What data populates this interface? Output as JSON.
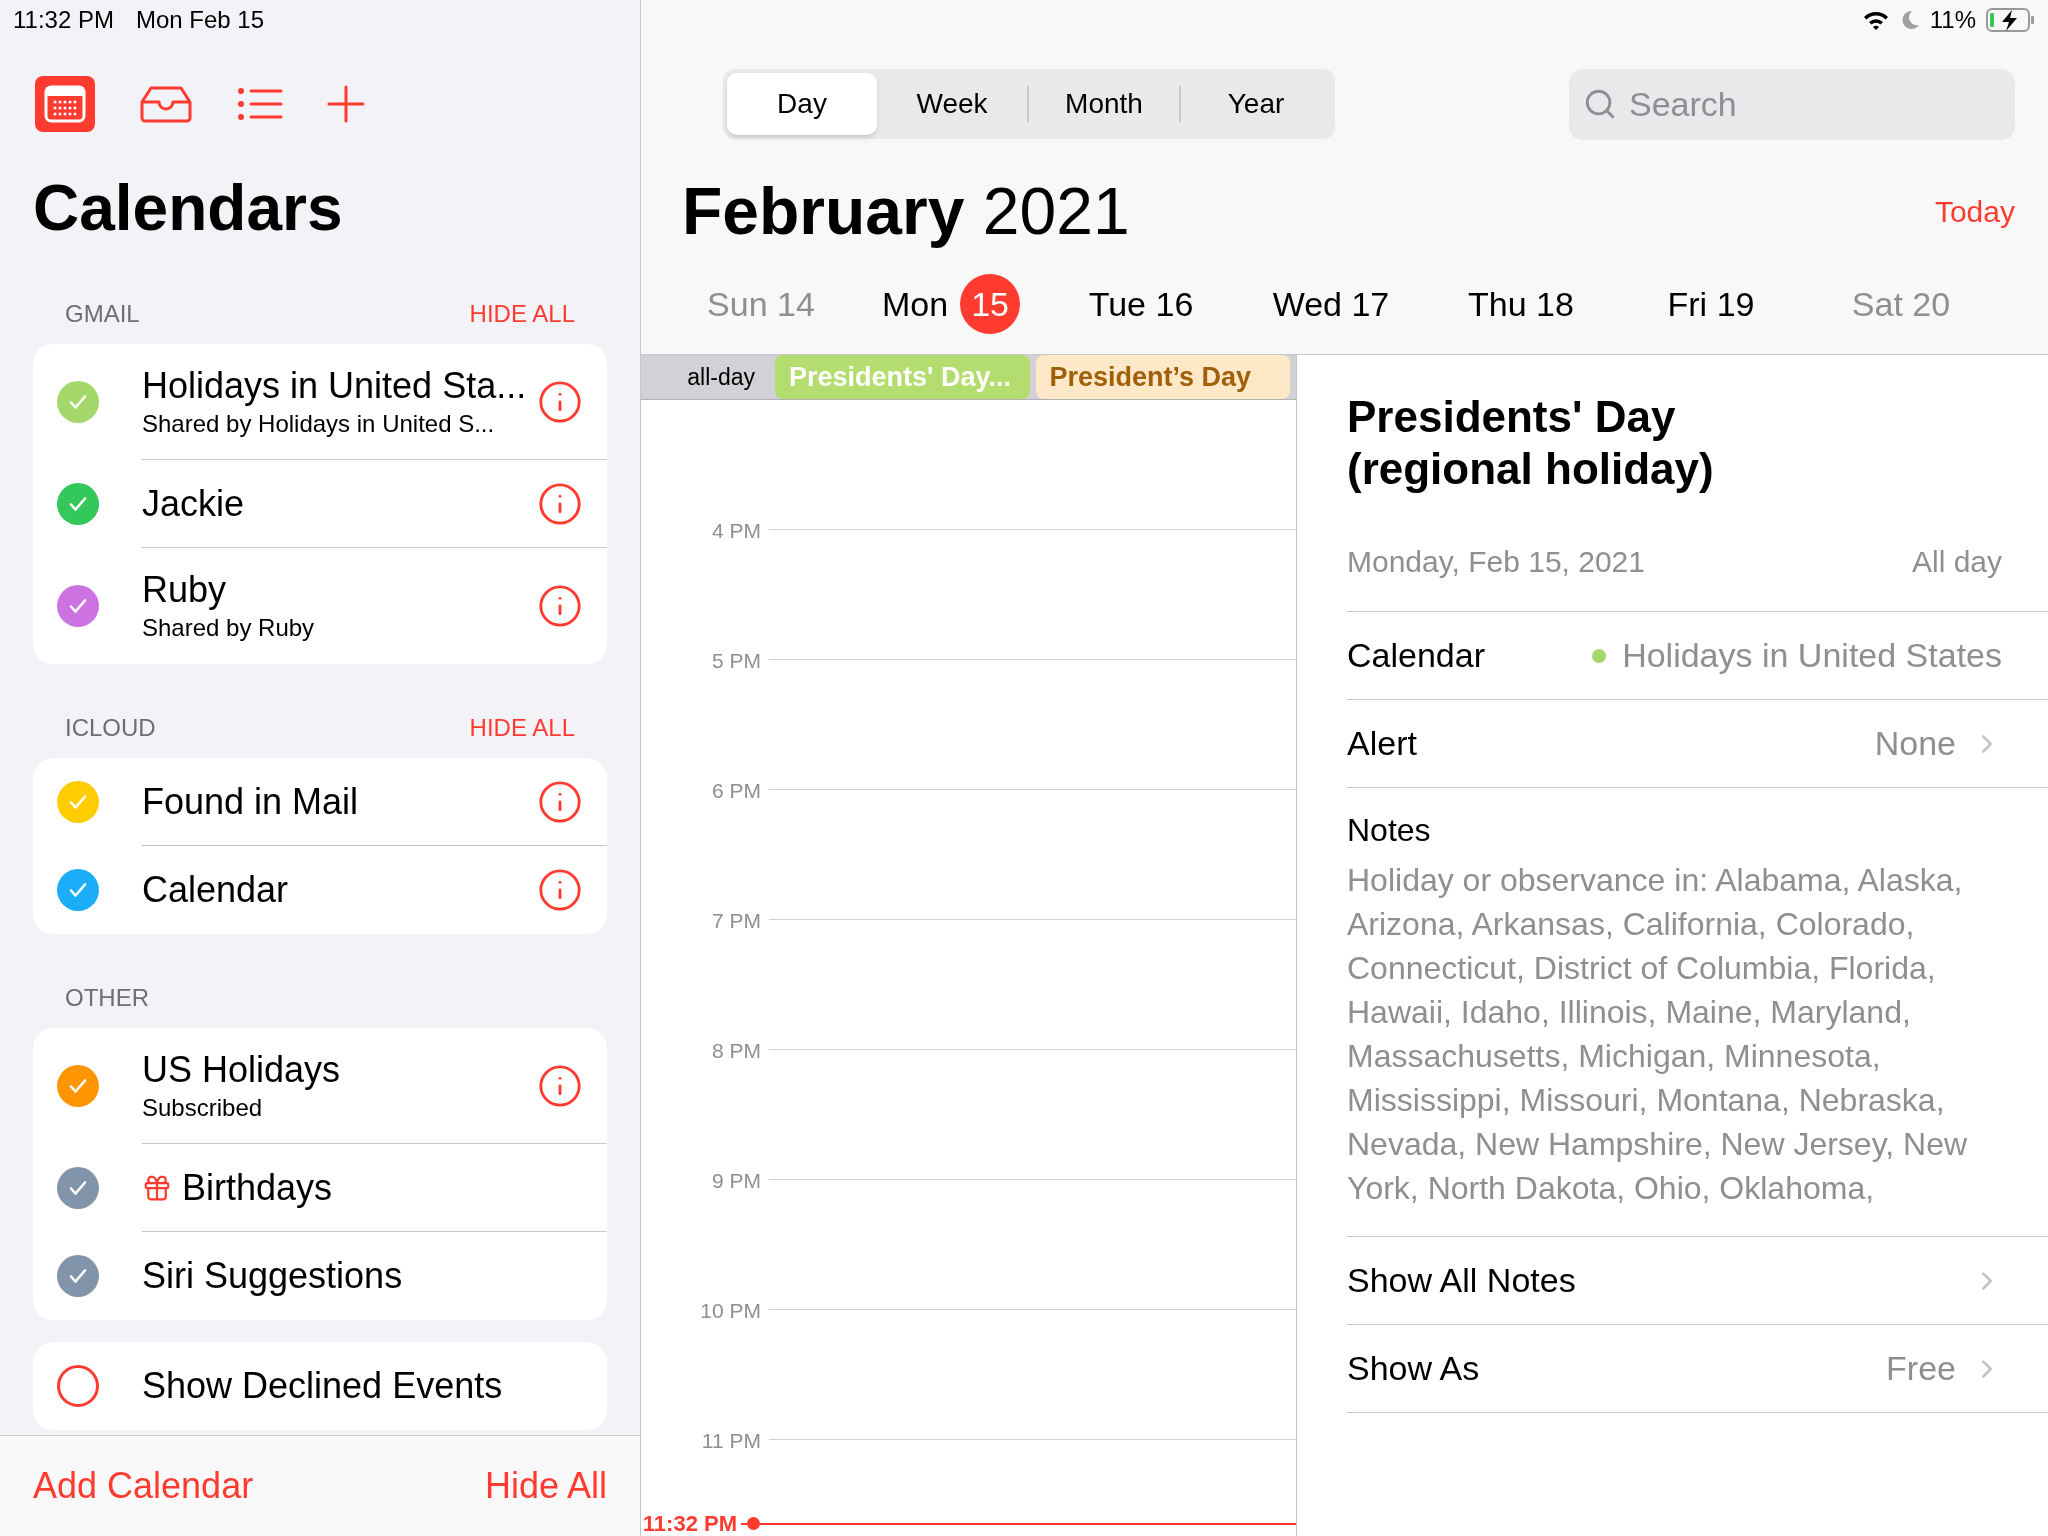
{
  "status_bar": {
    "time": "11:32 PM",
    "date": "Mon Feb 15",
    "battery": "11%"
  },
  "sidebar": {
    "title": "Calendars",
    "sections": [
      {
        "header": "GMAIL",
        "action": "HIDE ALL",
        "items": [
          {
            "kind": "calendar",
            "name": "Holidays in United Sta...",
            "subtitle": "Shared by Holidays in United S...",
            "color": "#a5d86a",
            "checked": true,
            "info": true
          },
          {
            "kind": "calendar",
            "name": "Jackie",
            "color": "#34c759",
            "checked": true,
            "info": true
          },
          {
            "kind": "calendar",
            "name": "Ruby",
            "subtitle": "Shared by Ruby",
            "color": "#cc73e1",
            "checked": true,
            "info": true
          }
        ]
      },
      {
        "header": "ICLOUD",
        "action": "HIDE ALL",
        "items": [
          {
            "kind": "calendar",
            "name": "Found in Mail",
            "color": "#ffcc00",
            "checked": true,
            "info": true
          },
          {
            "kind": "calendar",
            "name": "Calendar",
            "color": "#1badf8",
            "checked": true,
            "info": true
          }
        ]
      },
      {
        "header": "OTHER",
        "items": [
          {
            "kind": "calendar",
            "name": "US Holidays",
            "subtitle": "Subscribed",
            "color": "#ff9500",
            "checked": true,
            "info": true
          },
          {
            "kind": "birthdays",
            "name": "Birthdays",
            "color": "#8294aa",
            "checked": true,
            "info": false
          },
          {
            "kind": "calendar",
            "name": "Siri Suggestions",
            "color": "#8294aa",
            "checked": true,
            "info": false
          }
        ]
      }
    ],
    "declined": {
      "label": "Show Declined Events",
      "checked": false
    },
    "footer": {
      "add": "Add Calendar",
      "hide": "Hide All"
    }
  },
  "view_tabs": [
    {
      "label": "Day",
      "selected": true
    },
    {
      "label": "Week",
      "selected": false
    },
    {
      "label": "Month",
      "selected": false
    },
    {
      "label": "Year",
      "selected": false
    }
  ],
  "search": {
    "placeholder": "Search"
  },
  "header": {
    "month": "February",
    "year": "2021",
    "today": "Today"
  },
  "days": [
    {
      "weekday": "Sun",
      "day": "14",
      "today": false,
      "weekend": true
    },
    {
      "weekday": "Mon",
      "day": "15",
      "today": true,
      "weekend": false
    },
    {
      "weekday": "Tue",
      "day": "16",
      "today": false,
      "weekend": false
    },
    {
      "weekday": "Wed",
      "day": "17",
      "today": false,
      "weekend": false
    },
    {
      "weekday": "Thu",
      "day": "18",
      "today": false,
      "weekend": false
    },
    {
      "weekday": "Fri",
      "day": "19",
      "today": false,
      "weekend": false
    },
    {
      "weekday": "Sat",
      "day": "20",
      "today": false,
      "weekend": true
    }
  ],
  "all_day": {
    "label": "all-day",
    "events": [
      {
        "kind": "solid",
        "title": "Presidents' Day...",
        "color": "#b3dd6e"
      },
      {
        "kind": "tinted",
        "title": "President’s Day",
        "color": "#ffe8c8"
      }
    ]
  },
  "time_grid": {
    "hours": [
      "4 PM",
      "5 PM",
      "6 PM",
      "7 PM",
      "8 PM",
      "9 PM",
      "10 PM",
      "11 PM"
    ],
    "now": "11:32 PM"
  },
  "detail": {
    "title": "Presidents' Day (regional holiday)",
    "date": "Monday, Feb 15, 2021",
    "duration": "All day",
    "rows": [
      {
        "kind": "calendar",
        "label": "Calendar",
        "value": "Holidays in United States",
        "color": "#a5d86a"
      },
      {
        "kind": "link",
        "label": "Alert",
        "value": "None"
      }
    ],
    "notes": {
      "label": "Notes",
      "text": "Holiday or observance in: Alabama, Alaska, Arizona, Arkansas, California, Colorado, Connecticut, District of Columbia, Florida, Hawaii, Idaho, Illinois, Maine, Maryland, Massachusetts, Michigan, Minnesota, Mississippi, Missouri, Montana, Nebraska, Nevada, New Hampshire, New Jersey, New York, North Dakota, Ohio, Oklahoma,"
    },
    "more_rows": [
      {
        "kind": "link",
        "label": "Show All Notes"
      },
      {
        "kind": "link",
        "label": "Show As",
        "value": "Free"
      }
    ]
  }
}
